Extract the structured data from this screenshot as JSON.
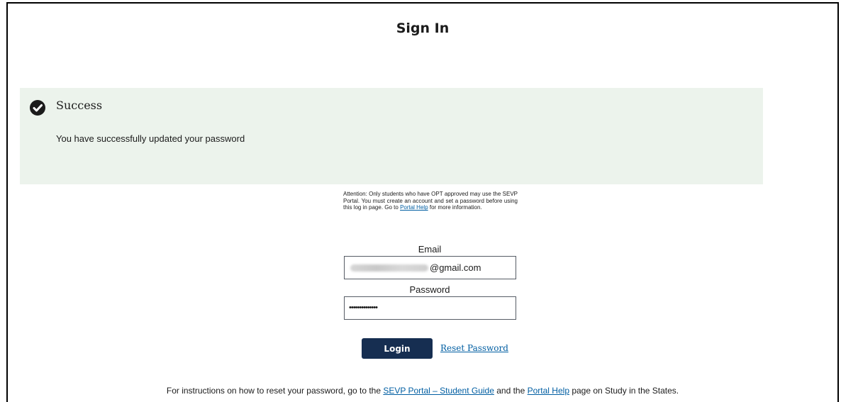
{
  "page": {
    "title": "Sign In"
  },
  "alert": {
    "heading": "Success",
    "message": "You have successfully updated your password",
    "icon": "check-circle-icon",
    "background": "#ecf3ec"
  },
  "attention": {
    "text_before": "Attention: Only students who have OPT approved may use the SEVP Portal. You must create an account and set a password before using this log in page. Go to ",
    "link": "Portal Help",
    "text_after": " for more information."
  },
  "form": {
    "email_label": "Email",
    "email_value_suffix": "@gmail.com",
    "password_label": "Password",
    "password_value": "••••••••••••••",
    "login_label": "Login",
    "reset_label": "Reset Password"
  },
  "footer": {
    "text1": "For instructions on how to reset your password, go to the ",
    "link1": "SEVP Portal – Student Guide",
    "text2": " and the ",
    "link2": "Portal Help",
    "text3": " page on Study in the States."
  },
  "colors": {
    "primary_button": "#162e51",
    "link": "#005ea2"
  }
}
